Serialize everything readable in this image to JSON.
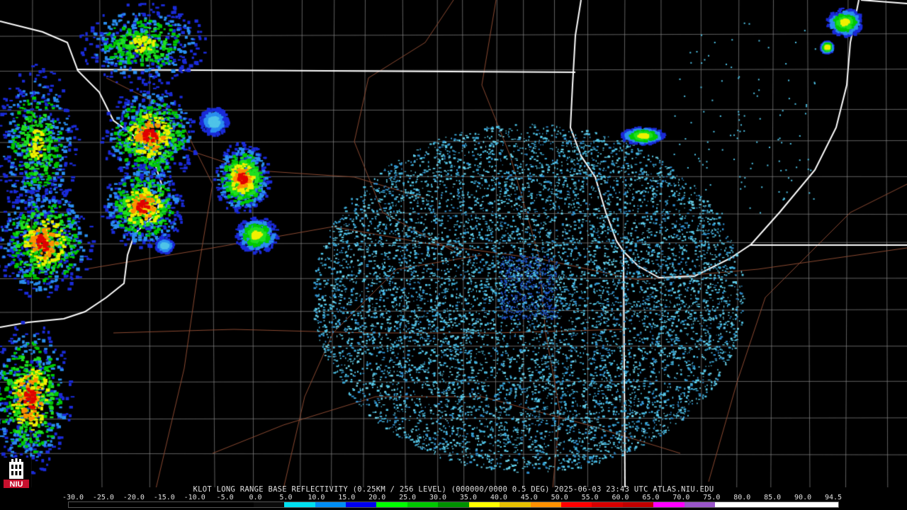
{
  "header": {
    "caption": "KLOT LONG RANGE BASE REFLECTIVITY (0.25KM / 256 LEVEL) (000000/0000 0.5 DEG) 2025-06-03 23:43 UTC  ATLAS.NIU.EDU"
  },
  "logo": {
    "text": "NIU",
    "icon": "niu-tower-logo-icon",
    "color": "#c8102e"
  },
  "legend": {
    "labels": [
      "-30.0",
      "-25.0",
      "-20.0",
      "-15.0",
      "-10.0",
      "-5.0",
      "0.0",
      "5.0",
      "10.0",
      "15.0",
      "20.0",
      "25.0",
      "30.0",
      "35.0",
      "40.0",
      "45.0",
      "50.0",
      "55.0",
      "60.0",
      "65.0",
      "70.0",
      "75.0",
      "80.0",
      "85.0",
      "90.0",
      "94.5"
    ],
    "colors": [
      "#000000",
      "#000000",
      "#000000",
      "#000000",
      "#000000",
      "#000000",
      "#0a0a0a",
      "#00e0f0",
      "#008ef5",
      "#0000f0",
      "#00ff00",
      "#00c800",
      "#009000",
      "#ffff00",
      "#e7c000",
      "#ff9000",
      "#ff0000",
      "#d60000",
      "#c00000",
      "#ff00ff",
      "#9955c9",
      "#ffffff",
      "#ffffff",
      "#ffffff",
      "#ffffff"
    ]
  },
  "map": {
    "boundary_color": "#ffffff",
    "county_color": "#8a8a8a",
    "road_color": "#8b4a32"
  }
}
